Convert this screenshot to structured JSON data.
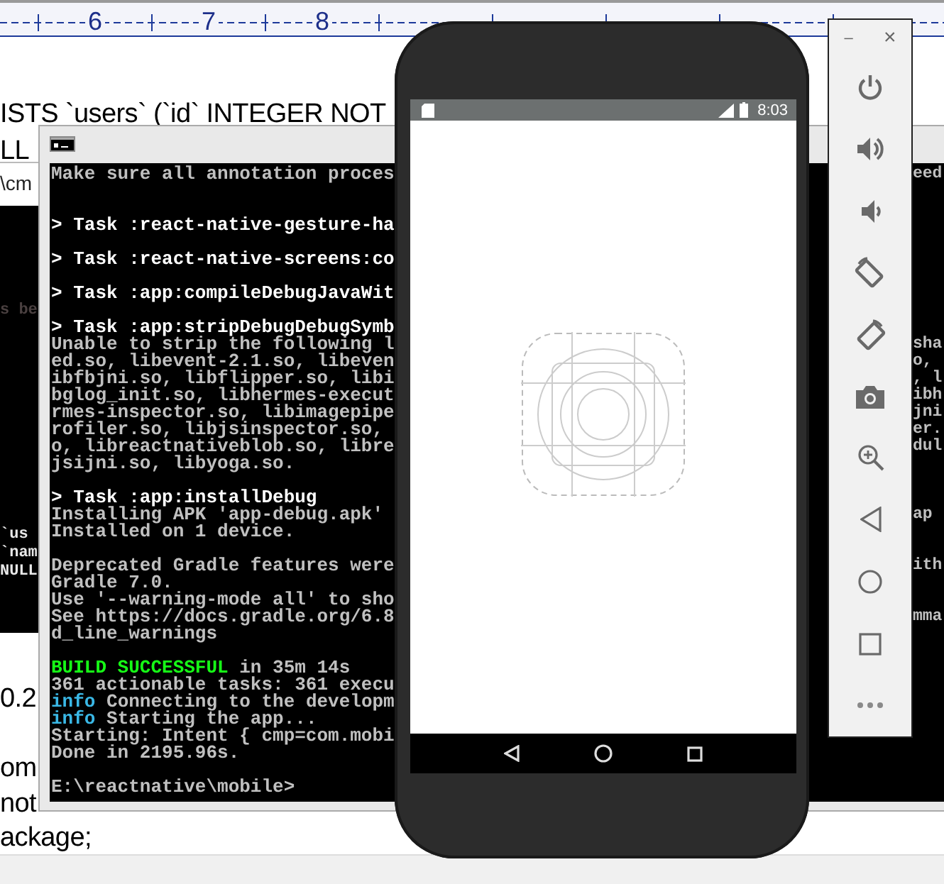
{
  "editor": {
    "ruler_labels": [
      "6",
      "7",
      "8"
    ],
    "lines": [
      "ISTS `users` (`id` INTEGER NOT",
      "LL",
      "0.2",
      "om",
      "not",
      "ackage;"
    ]
  },
  "back_console": {
    "title": "\\cm",
    "lines": [
      {
        "text": "s be",
        "color": "#4a4040"
      },
      {
        "text": "`us",
        "color": "#e8e8e8"
      },
      {
        "text": "`nam",
        "color": "#e8e8e8"
      },
      {
        "text": "NULL",
        "color": "#e8e8e8"
      }
    ]
  },
  "console": {
    "lines": [
      {
        "kind": "text",
        "parts": [
          {
            "text": "Make sure all annotation proces",
            "color": "#c0c0c0"
          }
        ],
        "tail": "eed"
      },
      {
        "kind": "blank"
      },
      {
        "kind": "blank"
      },
      {
        "kind": "text",
        "parts": [
          {
            "text": "> Task :react-native-gesture-ha",
            "color": "#ffffff"
          }
        ]
      },
      {
        "kind": "blank"
      },
      {
        "kind": "text",
        "parts": [
          {
            "text": "> Task :react-native-screens:co",
            "color": "#ffffff"
          }
        ]
      },
      {
        "kind": "blank"
      },
      {
        "kind": "text",
        "parts": [
          {
            "text": "> Task :app:compileDebugJavaWit",
            "color": "#ffffff"
          }
        ]
      },
      {
        "kind": "blank"
      },
      {
        "kind": "text",
        "parts": [
          {
            "text": "> Task :app:stripDebugDebugSymb",
            "color": "#ffffff"
          }
        ]
      },
      {
        "kind": "text",
        "parts": [
          {
            "text": "Unable to strip the following l",
            "color": "#c0c0c0"
          }
        ],
        "tail": "sha"
      },
      {
        "kind": "text",
        "parts": [
          {
            "text": "ed.so, libevent-2.1.so, libeven",
            "color": "#c0c0c0"
          }
        ],
        "tail": "o,"
      },
      {
        "kind": "text",
        "parts": [
          {
            "text": "ibfbjni.so, libflipper.so, libi",
            "color": "#c0c0c0"
          }
        ],
        "tail": ", l"
      },
      {
        "kind": "text",
        "parts": [
          {
            "text": "bglog_init.so, libhermes-execut",
            "color": "#c0c0c0"
          }
        ],
        "tail": "ibh"
      },
      {
        "kind": "text",
        "parts": [
          {
            "text": "rmes-inspector.so, libimagepipe",
            "color": "#c0c0c0"
          }
        ],
        "tail": "jni"
      },
      {
        "kind": "text",
        "parts": [
          {
            "text": "rofiler.so, libjsinspector.so,",
            "color": "#c0c0c0"
          }
        ],
        "tail": "er."
      },
      {
        "kind": "text",
        "parts": [
          {
            "text": "o, libreactnativeblob.so, libre",
            "color": "#c0c0c0"
          }
        ],
        "tail": "dul"
      },
      {
        "kind": "text",
        "parts": [
          {
            "text": "jsijni.so, libyoga.so.",
            "color": "#c0c0c0"
          }
        ]
      },
      {
        "kind": "blank"
      },
      {
        "kind": "text",
        "parts": [
          {
            "text": "> Task :app:installDebug",
            "color": "#ffffff"
          }
        ]
      },
      {
        "kind": "text",
        "parts": [
          {
            "text": "Installing APK 'app-debug.apk'",
            "color": "#c0c0c0"
          }
        ],
        "tail": "ap"
      },
      {
        "kind": "text",
        "parts": [
          {
            "text": "Installed on 1 device.",
            "color": "#c0c0c0"
          }
        ]
      },
      {
        "kind": "blank"
      },
      {
        "kind": "text",
        "parts": [
          {
            "text": "Deprecated Gradle features were",
            "color": "#c0c0c0"
          }
        ],
        "tail": "ith"
      },
      {
        "kind": "text",
        "parts": [
          {
            "text": "Gradle 7.0.",
            "color": "#c0c0c0"
          }
        ]
      },
      {
        "kind": "text",
        "parts": [
          {
            "text": "Use '--warning-mode all' to sho",
            "color": "#c0c0c0"
          }
        ]
      },
      {
        "kind": "text",
        "parts": [
          {
            "text": "See https://docs.gradle.org/6.8",
            "color": "#c0c0c0"
          }
        ],
        "tail": "mma"
      },
      {
        "kind": "text",
        "parts": [
          {
            "text": "d_line_warnings",
            "color": "#c0c0c0"
          }
        ]
      },
      {
        "kind": "blank"
      },
      {
        "kind": "text",
        "parts": [
          {
            "text": "BUILD SUCCESSFUL",
            "color": "#16ff16"
          },
          {
            "text": " in 35m 14s",
            "color": "#c0c0c0"
          }
        ]
      },
      {
        "kind": "text",
        "parts": [
          {
            "text": "361 actionable tasks: 361 execu",
            "color": "#c0c0c0"
          }
        ]
      },
      {
        "kind": "text",
        "parts": [
          {
            "text": "info",
            "color": "#3ab8e6"
          },
          {
            "text": " Connecting to the developm",
            "color": "#c0c0c0"
          }
        ]
      },
      {
        "kind": "text",
        "parts": [
          {
            "text": "info",
            "color": "#3ab8e6"
          },
          {
            "text": " Starting the app...",
            "color": "#c0c0c0"
          }
        ]
      },
      {
        "kind": "text",
        "parts": [
          {
            "text": "Starting: Intent { cmp=com.mobi",
            "color": "#c0c0c0"
          }
        ]
      },
      {
        "kind": "text",
        "parts": [
          {
            "text": "Done in 2195.96s.",
            "color": "#c0c0c0"
          }
        ]
      },
      {
        "kind": "blank"
      },
      {
        "kind": "text",
        "parts": [
          {
            "text": "E:\\reactnative\\mobile>",
            "color": "#c0c0c0"
          }
        ]
      }
    ]
  },
  "phone": {
    "time": "8:03"
  },
  "emulator_toolbar": {
    "minimize": "–",
    "close": "×"
  }
}
